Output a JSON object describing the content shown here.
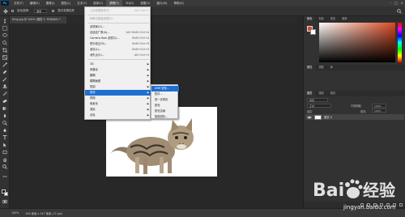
{
  "menubar": {
    "logo": "Ps",
    "items": [
      {
        "label": "文件(F)"
      },
      {
        "label": "编辑(E)"
      },
      {
        "label": "图像(I)"
      },
      {
        "label": "图层(L)"
      },
      {
        "label": "文字(Y)"
      },
      {
        "label": "选择(S)"
      },
      {
        "label": "滤镜(T)"
      },
      {
        "label": "3D(D)"
      },
      {
        "label": "视图(V)"
      },
      {
        "label": "窗口(W)"
      },
      {
        "label": "帮助(H)"
      }
    ],
    "active_index": 6,
    "window_controls": [
      "–",
      "□",
      "×"
    ]
  },
  "optbar": {
    "auto_select": "自动选择:",
    "layer_select": "图层",
    "show_transform": "显示变换控件"
  },
  "tab": {
    "title": "timg.jpg @ 100% (图层 0, RGB/8#) *"
  },
  "filter_menu": {
    "items": [
      {
        "label": "上次滤镜操作(F)",
        "shortcut": "Alt+Ctrl+F",
        "disabled": true
      },
      {
        "label": "转换为智能滤镜(S)",
        "shortcut": "",
        "disabled": true
      },
      {
        "label": "滤镜库(G)...",
        "shortcut": ""
      },
      {
        "label": "自适应广角(A)...",
        "shortcut": "Alt+Shift+Ctrl+A"
      },
      {
        "label": "Camera Raw 滤镜(C)...",
        "shortcut": "Shift+Ctrl+A"
      },
      {
        "label": "镜头校正(R)...",
        "shortcut": "Shift+Ctrl+R"
      },
      {
        "label": "液化(L)...",
        "shortcut": "Shift+Ctrl+X"
      },
      {
        "label": "消失点(V)...",
        "shortcut": "Alt+Ctrl+V"
      },
      {
        "label": "3D",
        "shortcut": "",
        "submenu": true
      },
      {
        "label": "风格化",
        "shortcut": "",
        "submenu": true
      },
      {
        "label": "模糊",
        "shortcut": "",
        "submenu": true
      },
      {
        "label": "模糊画廊",
        "shortcut": "",
        "submenu": true
      },
      {
        "label": "扭曲",
        "shortcut": "",
        "submenu": true
      },
      {
        "label": "锐化",
        "shortcut": "",
        "submenu": true,
        "highlighted": true
      },
      {
        "label": "视频",
        "shortcut": "",
        "submenu": true
      },
      {
        "label": "像素化",
        "shortcut": "",
        "submenu": true
      },
      {
        "label": "渲染",
        "shortcut": "",
        "submenu": true
      },
      {
        "label": "杂色",
        "shortcut": "",
        "submenu": true
      },
      {
        "label": "其它",
        "shortcut": "",
        "submenu": true
      }
    ]
  },
  "sharpen_submenu": {
    "items": [
      {
        "label": "USM 锐化...",
        "highlighted": true
      },
      {
        "label": "防抖..."
      },
      {
        "label": "进一步锐化"
      },
      {
        "label": "锐化"
      },
      {
        "label": "锐化边缘"
      },
      {
        "label": "智能锐化..."
      }
    ]
  },
  "right_panel": {
    "color_tabs": [
      "颜色",
      "色板",
      "渐变",
      "图案"
    ],
    "properties_tabs": [
      "属性",
      "调整",
      "库"
    ],
    "layers_tabs": [
      "图层",
      "通道",
      "路径"
    ],
    "kind_label": "类型",
    "blend_mode": "正常",
    "opacity_label": "不透明度:",
    "opacity_value": "100%",
    "lock_label": "锁定:",
    "fill_label": "填充:",
    "fill_value": "100%",
    "layer_name": "图层 0"
  },
  "statusbar": {
    "zoom": "100%",
    "info": "500 像素 x 347 像素 (72 ppi)"
  },
  "colors": {
    "fg_color_panel": "#d94a22",
    "menu_highlight": "#1f6fd1"
  },
  "watermark": {
    "brand": "Baidu经验",
    "url": "jingyan.baidu.com"
  }
}
